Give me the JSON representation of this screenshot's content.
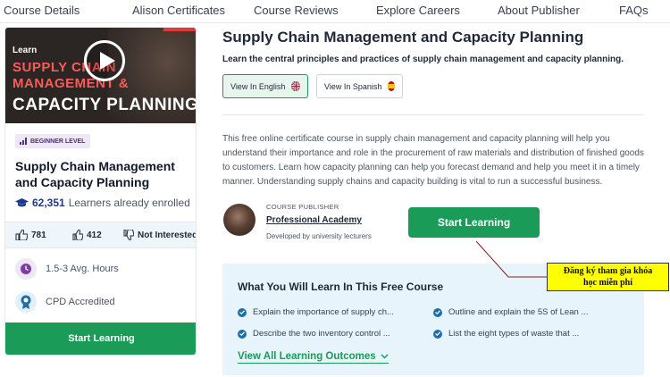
{
  "topnav": {
    "items": [
      "Course Details",
      "Alison Certificates",
      "Course Reviews",
      "Explore Careers",
      "About Publisher",
      "FAQs"
    ]
  },
  "sidebar_card": {
    "thumbnail": {
      "learn": "Learn",
      "line1": "SUPPLY CHAIN",
      "line2": "MANAGEMENT &",
      "line3": "CAPACITY PLANNING"
    },
    "level_badge": "BEGINNER LEVEL",
    "title": "Supply Chain Management and Capacity Planning",
    "enrolled_count": "62,351",
    "enrolled_text": "Learners already enrolled",
    "likes": "781",
    "thumbs_up": "412",
    "not_interested": "Not Interested",
    "hours": "1.5-3 Avg. Hours",
    "cpd": "CPD Accredited",
    "start_button": "Start Learning"
  },
  "main": {
    "title": "Supply Chain Management and Capacity Planning",
    "subtitle": "Learn the central principles and practices of supply chain management and capacity planning.",
    "view_english": "View In English",
    "view_spanish": "View In Spanish",
    "description": "This free online certificate course in supply chain management and capacity planning will help you understand their importance and role in the procurement of raw materials and distribution of finished goods to customers. Learn how capacity planning can help you forecast demand and help you meet it in a timely manner. Understanding supply chains and capacity building is vital to run a successful business.",
    "publisher_label": "COURSE PUBLISHER",
    "publisher_name": "Professional Academy",
    "publisher_note": "Developed by university lecturers",
    "start_button": "Start Learning",
    "outcomes_heading": "What You Will Learn In This Free Course",
    "outcomes": [
      "Explain the importance of supply ch...",
      "Outline and explain the 5S of Lean ...",
      "Describe the two inventory control ...",
      "List the eight types of waste that ..."
    ],
    "view_all": "View All Learning Outcomes"
  },
  "annotation": {
    "line1": "Đăng ký tham gia khóa",
    "line2": "học miễn phí"
  },
  "colors": {
    "brand_green": "#1a9b58",
    "annotation_yellow": "#ffff00",
    "annotation_line": "#8b1a1a"
  }
}
